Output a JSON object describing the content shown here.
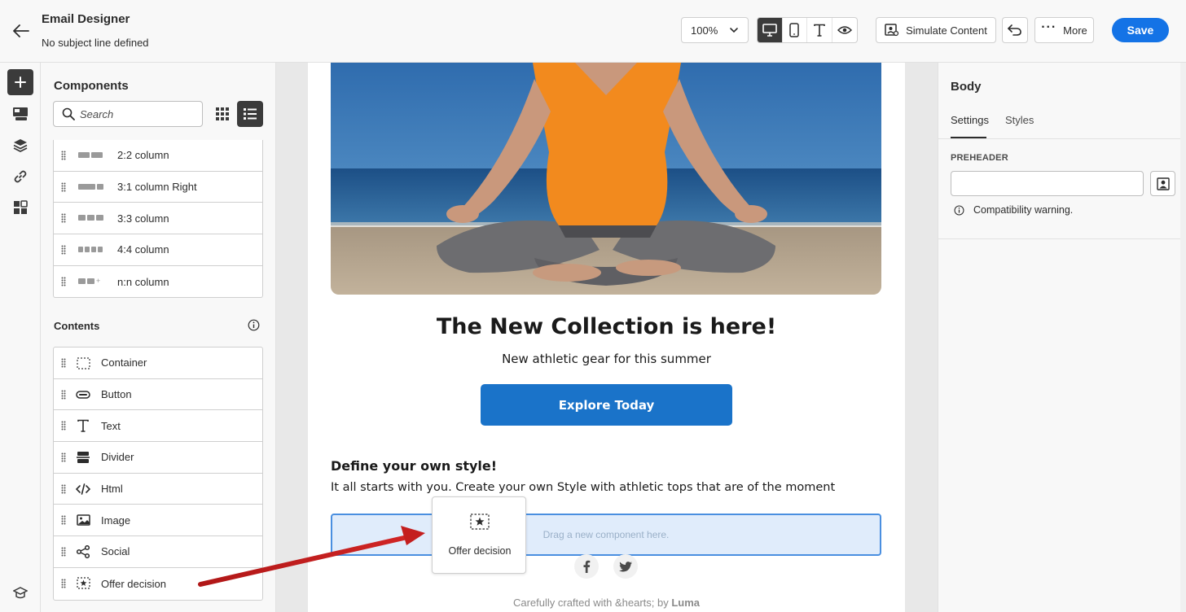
{
  "header": {
    "title": "Email Designer",
    "subtitle": "No subject line defined",
    "zoom": "100%",
    "simulate_label": "Simulate Content",
    "more_label": "More",
    "save_label": "Save"
  },
  "components_panel": {
    "title": "Components",
    "search_placeholder": "Search",
    "structures": [
      {
        "label": "2:2 column"
      },
      {
        "label": "3:1 column Right"
      },
      {
        "label": "3:3 column"
      },
      {
        "label": "4:4 column"
      },
      {
        "label": "n:n column"
      }
    ],
    "contents_title": "Contents",
    "contents": [
      {
        "label": "Container",
        "icon": "container-icon"
      },
      {
        "label": "Button",
        "icon": "button-icon"
      },
      {
        "label": "Text",
        "icon": "text-icon"
      },
      {
        "label": "Divider",
        "icon": "divider-icon"
      },
      {
        "label": "Html",
        "icon": "code-icon"
      },
      {
        "label": "Image",
        "icon": "image-icon"
      },
      {
        "label": "Social",
        "icon": "share-icon"
      },
      {
        "label": "Offer decision",
        "icon": "offer-decision-icon"
      }
    ]
  },
  "email": {
    "headline": "The New Collection is here!",
    "subhead": "New athletic gear for this summer",
    "cta_label": "Explore Today",
    "section_title": "Define your own style!",
    "section_body": "It all starts with you. Create your own Style with athletic tops that are of the moment",
    "dropzone_text": "Drag a new component here.",
    "footer_prefix": "Carefully crafted with &hearts; by",
    "footer_brand": "Luma"
  },
  "drag_card": {
    "label": "Offer decision"
  },
  "properties_panel": {
    "title": "Body",
    "tabs": [
      "Settings",
      "Styles"
    ],
    "preheader_label": "PREHEADER",
    "warning_text": "Compatibility warning."
  },
  "colors": {
    "accent": "#1473e6",
    "cta": "#1a73c9",
    "arrow": "#c41e1e",
    "dropzone_bg": "#e0ecfb"
  }
}
